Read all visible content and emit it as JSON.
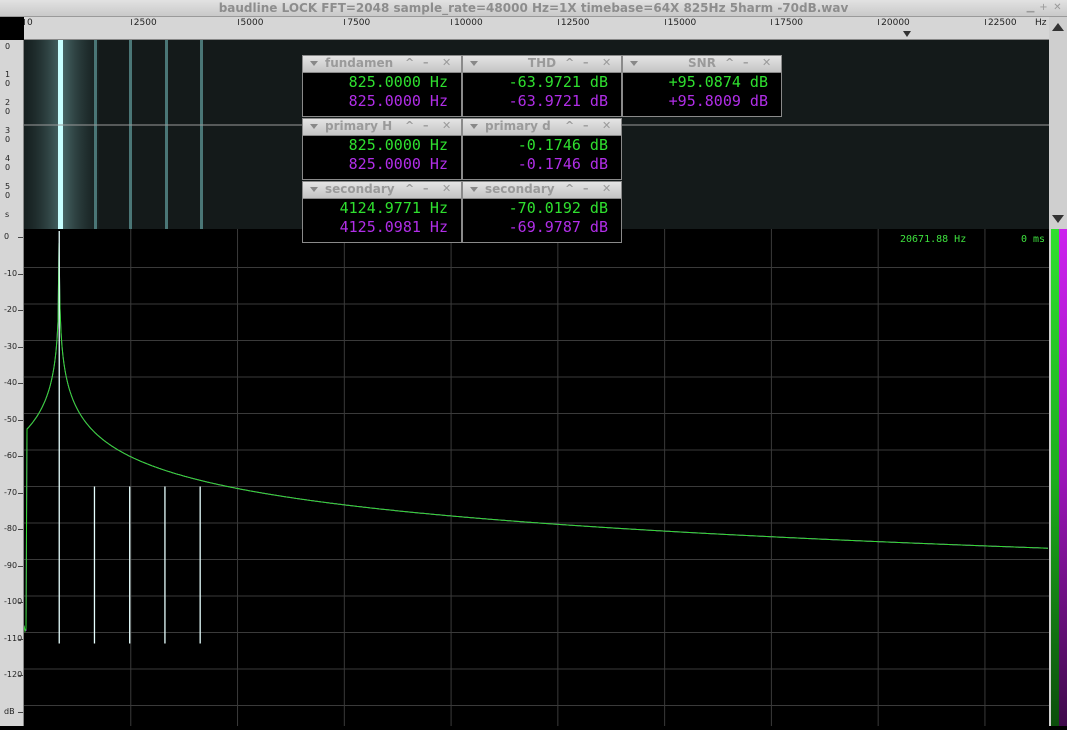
{
  "window": {
    "title": "baudline  LOCK FFT=2048 sample_rate=48000 Hz=1X timebase=64X  825Hz  5harm  -70dB.wav"
  },
  "x_ruler": {
    "labels": [
      "0",
      "2500",
      "5000",
      "7500",
      "10000",
      "12500",
      "15000",
      "17500",
      "20000",
      "22500"
    ],
    "unit": "Hz"
  },
  "time_ruler": {
    "labels": [
      "0",
      "1\n0",
      "2\n0",
      "3\n0",
      "4\n0",
      "5\n0",
      "s"
    ]
  },
  "db_ruler": {
    "labels": [
      "0",
      "-10",
      "-20",
      "-30",
      "-40",
      "-50",
      "-60",
      "-70",
      "-80",
      "-90",
      "-100",
      "-110",
      "-120",
      "dB"
    ]
  },
  "readouts": {
    "frequency": "20671.88 Hz",
    "time": "0 ms"
  },
  "panels": [
    {
      "title": "fundamen",
      "line1": "825.0000 Hz",
      "line2": "825.0000 Hz"
    },
    {
      "title": "THD",
      "line1": "-63.9721 dB",
      "line2": "-63.9721 dB"
    },
    {
      "title": "SNR",
      "line1": "+95.0874 dB",
      "line2": "+95.8009 dB"
    },
    {
      "title": "primary H",
      "line1": "825.0000 Hz",
      "line2": "825.0000 Hz"
    },
    {
      "title": "primary d",
      "line1": "-0.1746 dB",
      "line2": "-0.1746 dB"
    },
    {
      "title": "secondary",
      "line1": "4124.9771 Hz",
      "line2": "4125.0981 Hz"
    },
    {
      "title": "secondary",
      "line1": "-70.0192 dB",
      "line2": "-69.9787 dB"
    }
  ],
  "colors": {
    "channel1": "#2fe02f",
    "channel2": "#b12ee8",
    "grid": "#3a3a3a"
  },
  "chart_data": {
    "type": "line",
    "xlabel": "Hz",
    "ylabel": "dB",
    "xlim": [
      0,
      24000
    ],
    "ylim": [
      -130,
      0
    ],
    "grid": true,
    "peaks": [
      {
        "freq": 825,
        "db": 0
      },
      {
        "freq": 1650,
        "db": -70
      },
      {
        "freq": 2475,
        "db": -70
      },
      {
        "freq": 3300,
        "db": -70
      },
      {
        "freq": 4125,
        "db": -70
      }
    ],
    "noise_floor_db": -123
  }
}
